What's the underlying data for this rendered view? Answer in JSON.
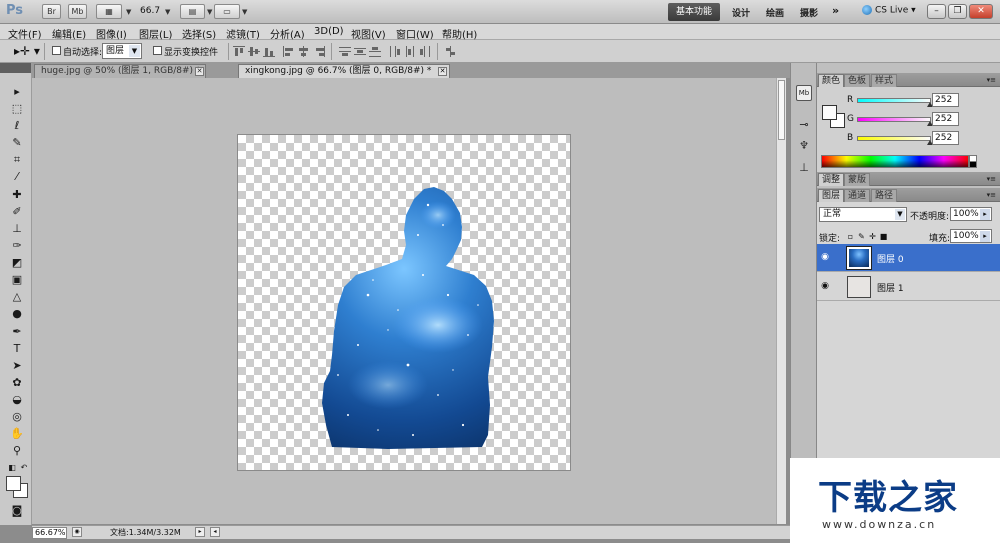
{
  "app": {
    "logo": "Ps",
    "bridge_btn": "Br",
    "minibridge_btn": "Mb",
    "zoom_level": "66.7",
    "workspaces": [
      "基本功能",
      "设计",
      "绘画",
      "摄影"
    ],
    "more": "»",
    "cs_live": "CS Live"
  },
  "menu": [
    "文件(F)",
    "编辑(E)",
    "图像(I)",
    "图层(L)",
    "选择(S)",
    "滤镜(T)",
    "分析(A)",
    "3D(D)",
    "视图(V)",
    "窗口(W)",
    "帮助(H)"
  ],
  "options": {
    "auto_select_label": "自动选择:",
    "auto_select_value": "图层",
    "show_transform_label": "显示变换控件"
  },
  "tabs": [
    {
      "label": "huge.jpg @ 50% (图层 1, RGB/8#) *"
    },
    {
      "label": "xingkong.jpg @ 66.7% (图层 0, RGB/8#) *"
    }
  ],
  "status": {
    "zoom": "66.67%",
    "doc_info": "文档:1.34M/3.32M"
  },
  "color_panel": {
    "tabs": [
      "颜色",
      "色板",
      "样式"
    ],
    "r_label": "R",
    "g_label": "G",
    "b_label": "B",
    "r": "252",
    "g": "252",
    "b": "252",
    "fg_color": "#fcfcfc"
  },
  "adjust_panel": {
    "tabs": [
      "调整",
      "蒙版"
    ]
  },
  "layers_panel": {
    "tabs": [
      "图层",
      "通道",
      "路径"
    ],
    "blend_mode": "正常",
    "opacity_label": "不透明度:",
    "opacity": "100%",
    "lock_label": "锁定:",
    "fill_label": "填充:",
    "fill": "100%",
    "layers": [
      {
        "name": "图层 0",
        "selected": true
      },
      {
        "name": "图层 1",
        "selected": false
      }
    ],
    "selection_color": "#3a6fcb"
  },
  "watermark": {
    "title": "下载之家",
    "url": "www.downza.cn"
  }
}
